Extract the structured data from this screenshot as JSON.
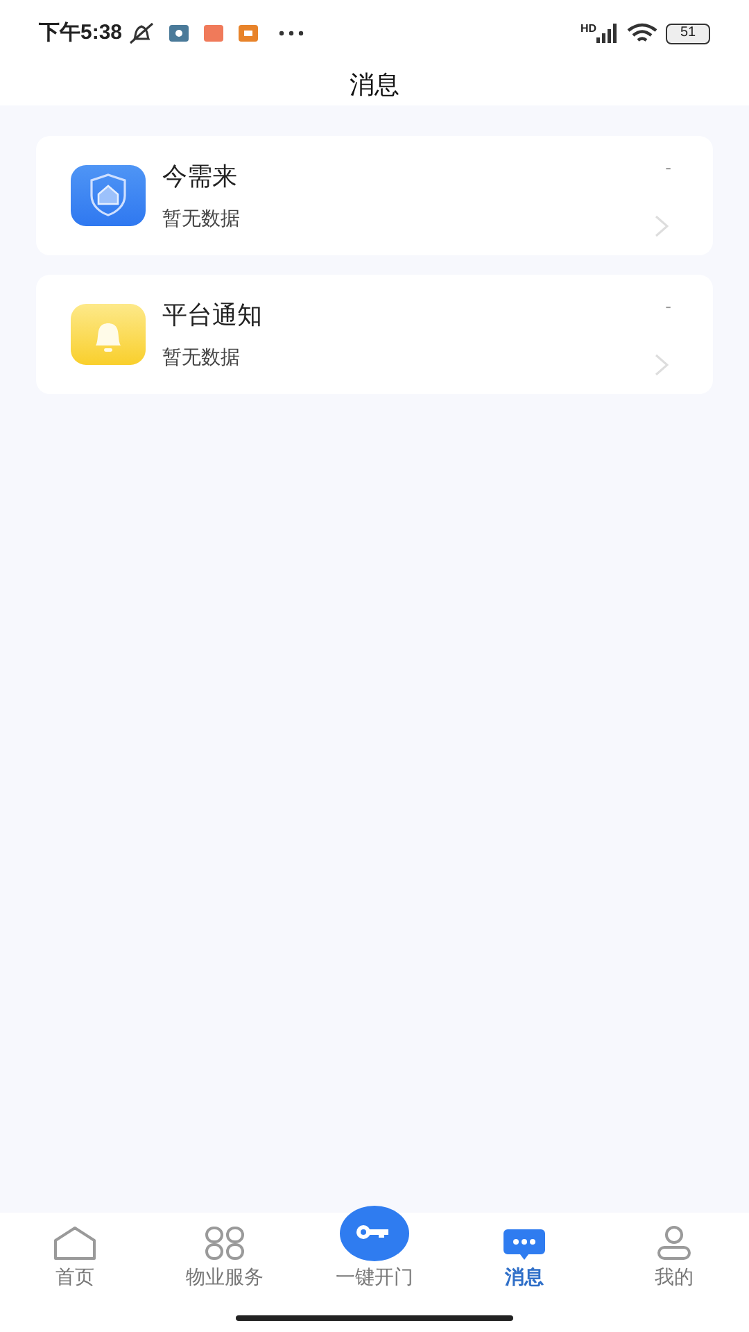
{
  "status_bar": {
    "time": "下午5:38",
    "network": "HD",
    "battery": "51"
  },
  "header": {
    "title": "消息"
  },
  "messages": [
    {
      "kind": "shield",
      "title": "今需来",
      "preview": "暂无数据",
      "time": "-"
    },
    {
      "kind": "bell",
      "title": "平台通知",
      "preview": "暂无数据",
      "time": "-"
    }
  ],
  "tab_bar": [
    {
      "kind": "home",
      "label": "首页",
      "selected": false
    },
    {
      "kind": "grid",
      "label": "物业服务",
      "selected": false
    },
    {
      "kind": "key",
      "label": "一键开门",
      "selected": false
    },
    {
      "kind": "chat",
      "label": "消息",
      "selected": true
    },
    {
      "kind": "user",
      "label": "我的",
      "selected": false
    }
  ]
}
